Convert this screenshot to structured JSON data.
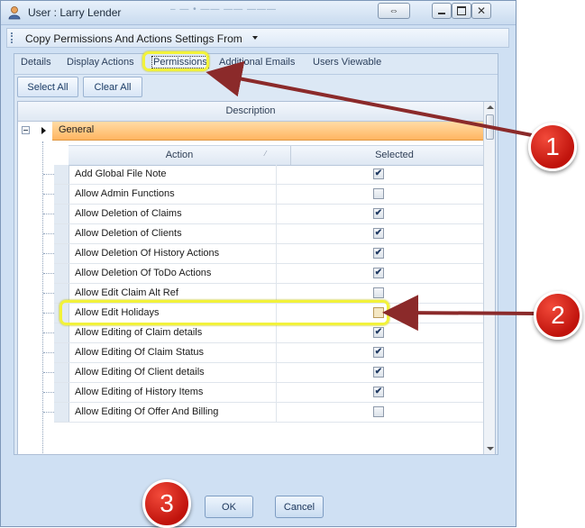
{
  "window": {
    "title": "User : Larry Lender",
    "title_ghost": "–  — • ——  —— ———"
  },
  "menu": {
    "item": "Copy Permissions And Actions Settings From"
  },
  "tabs": [
    {
      "label": "Details"
    },
    {
      "label": "Display Actions"
    },
    {
      "label": "Permissions",
      "active": true
    },
    {
      "label": "Additional Emails"
    },
    {
      "label": "Users Viewable"
    }
  ],
  "toolbar": {
    "select_all": "Select All",
    "clear_all": "Clear All"
  },
  "grid": {
    "description_header": "Description",
    "group_label": "General",
    "columns": {
      "action": "Action",
      "selected": "Selected"
    },
    "rows": [
      {
        "action": "Add Global File Note",
        "selected": true
      },
      {
        "action": "Allow Admin Functions",
        "selected": false
      },
      {
        "action": "Allow Deletion of Claims",
        "selected": true
      },
      {
        "action": "Allow Deletion of Clients",
        "selected": true
      },
      {
        "action": "Allow Deletion Of History Actions",
        "selected": true
      },
      {
        "action": "Allow Deletion Of ToDo Actions",
        "selected": true
      },
      {
        "action": "Allow Edit Claim Alt Ref",
        "selected": false
      },
      {
        "action": "Allow Edit Holidays",
        "selected": false,
        "hover": true
      },
      {
        "action": "Allow Editing of Claim details",
        "selected": true
      },
      {
        "action": "Allow Editing Of Claim Status",
        "selected": true
      },
      {
        "action": "Allow Editing Of Client details",
        "selected": true
      },
      {
        "action": "Allow Editing of History Items",
        "selected": true
      },
      {
        "action": "Allow Editing Of Offer And Billing",
        "selected": false
      }
    ]
  },
  "footer": {
    "ok": "OK",
    "cancel": "Cancel"
  },
  "annotations": {
    "callout_1": "1",
    "callout_2": "2",
    "callout_3": "3",
    "color_highlight": "#f2f23a",
    "color_callout": "#d11a12",
    "color_arrow": "#8b2a2a"
  }
}
